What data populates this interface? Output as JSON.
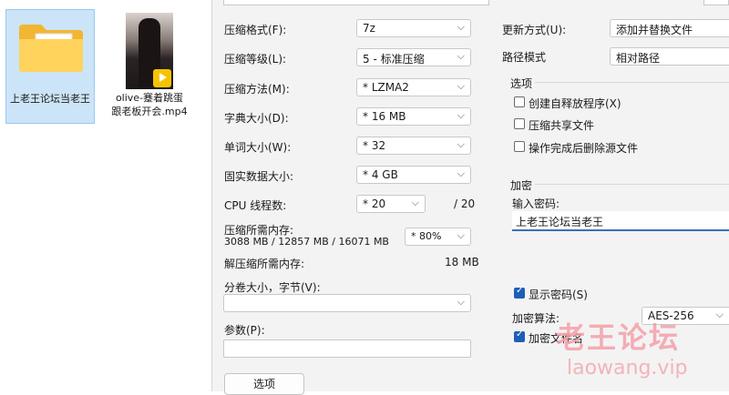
{
  "explorer": {
    "files": [
      {
        "name": "上老王论坛当老王",
        "icon": "folder-icon"
      },
      {
        "name": "olive-蹇着跳蛋跟老板开会.mp4",
        "icon": "video-thumbnail"
      }
    ]
  },
  "dialog": {
    "left": {
      "format_label": "压缩格式(F):",
      "format_value": "7z",
      "level_label": "压缩等级(L):",
      "level_value": "5 - 标准压缩",
      "method_label": "压缩方法(M):",
      "method_value": "* LZMA2",
      "dict_label": "字典大小(D):",
      "dict_value": "* 16 MB",
      "word_label": "单词大小(W):",
      "word_value": "* 32",
      "solid_label": "固实数据大小:",
      "solid_value": "* 4 GB",
      "threads_label": "CPU 线程数:",
      "threads_value": "* 20",
      "threads_max": "/ 20",
      "mem_comp_label": "压缩所需内存:",
      "mem_comp_detail": "3088 MB / 12857 MB / 16071 MB",
      "mem_percent": "* 80%",
      "mem_decomp_label": "解压缩所需内存:",
      "mem_decomp_value": "18 MB",
      "split_label": "分卷大小，字节(V):",
      "split_value": "",
      "params_label": "参数(P):",
      "params_value": "",
      "options_button": "选项"
    },
    "right": {
      "update_label": "更新方式(U):",
      "update_value": "添加并替换文件",
      "path_label": "路径模式",
      "path_value": "相对路径",
      "options_title": "选项",
      "opt_sfx": "创建自释放程序(X)",
      "opt_shared": "压缩共享文件",
      "opt_delete": "操作完成后删除源文件",
      "encrypt_title": "加密",
      "pw_label": "输入密码:",
      "pw_value": "上老王论坛当老王",
      "show_pw": "显示密码(S)",
      "algo_label": "加密算法:",
      "algo_value": "AES-256",
      "encrypt_names": "加密文件名"
    }
  },
  "watermark": {
    "cn": "老王论坛",
    "en": "laowang.vip"
  },
  "colors": {
    "accent": "#1d5fb8",
    "selection": "#cce4f7",
    "watermark": "#f4a0a8"
  }
}
